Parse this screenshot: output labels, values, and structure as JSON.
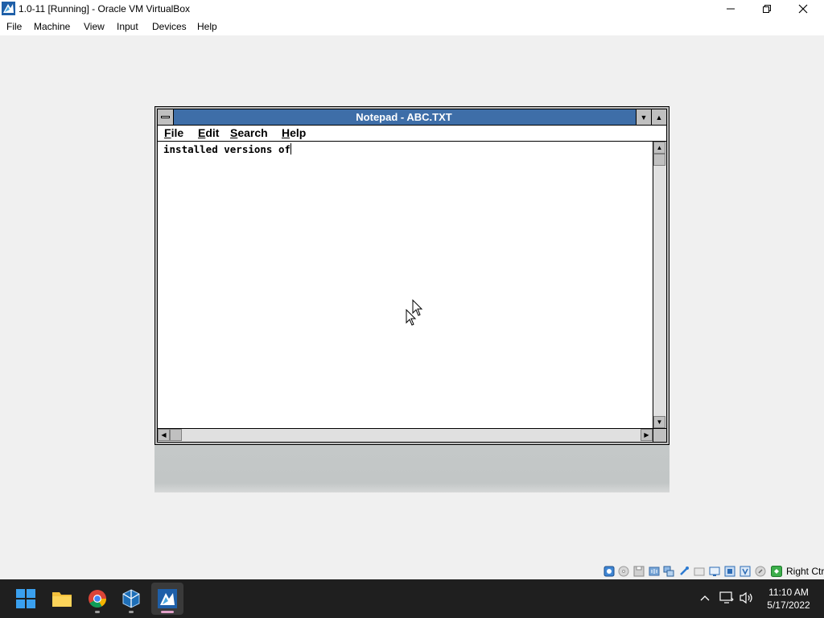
{
  "host_window": {
    "title": "1.0-11 [Running] - Oracle VM VirtualBox",
    "menu": [
      "File",
      "Machine",
      "View",
      "Input",
      "Devices",
      "Help"
    ],
    "host_key_label": "Right Ctrl"
  },
  "notepad": {
    "title": "Notepad - ABC.TXT",
    "menu": [
      {
        "label": "File",
        "underline": "F"
      },
      {
        "label": "Edit",
        "underline": "E"
      },
      {
        "label": "Search",
        "underline": "S"
      },
      {
        "label": "Help",
        "underline": "H"
      }
    ],
    "content": "installed versions of"
  },
  "status_icons": [
    "hard-disk-icon",
    "optical-drive-icon",
    "floppy-icon",
    "audio-icon",
    "network-icon",
    "usb-icon",
    "shared-folders-icon",
    "display-icon",
    "recording-icon",
    "cpu-icon",
    "mouse-integration-icon",
    "host-key-icon"
  ],
  "taskbar": {
    "apps": [
      {
        "name": "start-button",
        "icon": "windows-logo-icon"
      },
      {
        "name": "file-explorer",
        "icon": "folder-icon"
      },
      {
        "name": "chrome",
        "icon": "chrome-icon"
      },
      {
        "name": "virtualbox",
        "icon": "virtualbox-icon"
      },
      {
        "name": "vm-window",
        "icon": "vm-icon",
        "active": true
      }
    ],
    "clock": {
      "time": "11:10 AM",
      "date": "5/17/2022"
    }
  },
  "colors": {
    "notepad_titlebar": "#3e6ea8",
    "taskbar_bg": "#1f1f1f",
    "active_indicator": "#e0a0c8"
  }
}
